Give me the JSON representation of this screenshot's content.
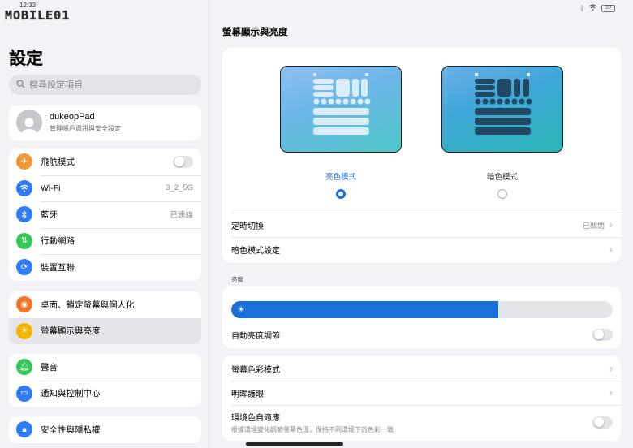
{
  "header": {
    "clock": "12:33",
    "logo_text": "MOBILE01"
  },
  "status": {
    "battery": "10"
  },
  "sidebar": {
    "title": "設定",
    "search_placeholder": "搜尋設定項目",
    "profile": {
      "name": "dukeopPad",
      "subtitle": "管理帳戶資訊與安全設定"
    },
    "group1": [
      {
        "label": "飛航模式",
        "icon": "airplane-icon",
        "color": "#f09a37"
      },
      {
        "label": "Wi-Fi",
        "value": "3_2_5G",
        "icon": "wifi-icon",
        "color": "#2f7cf6"
      },
      {
        "label": "藍牙",
        "value": "已連線",
        "icon": "bluetooth-icon",
        "color": "#2f7cf6"
      },
      {
        "label": "行動網路",
        "icon": "cellular-icon",
        "color": "#34c759"
      },
      {
        "label": "裝置互聯",
        "icon": "continuity-icon",
        "color": "#2f7cf6"
      }
    ],
    "group2": [
      {
        "label": "桌面、鎖定螢幕與個人化",
        "icon": "palette-icon",
        "color": "#f2742b"
      },
      {
        "label": "螢幕顯示與亮度",
        "icon": "brightness-icon",
        "color": "#f5b400"
      }
    ],
    "group3": [
      {
        "label": "聲音",
        "icon": "bell-icon",
        "color": "#34c759"
      },
      {
        "label": "通知與控制中心",
        "icon": "notification-icon",
        "color": "#2f7cf6"
      }
    ],
    "group4": [
      {
        "label": "安全性與隱私權",
        "icon": "lock-icon",
        "color": "#2f7cf6"
      }
    ]
  },
  "main": {
    "title": "螢幕顯示與亮度",
    "light_mode_label": "亮色模式",
    "dark_mode_label": "暗色模式",
    "schedule_label": "定時切換",
    "schedule_value": "已關閉",
    "dark_settings_label": "暗色模式設定",
    "brightness_section": "亮度",
    "brightness_level": 0.7,
    "auto_brightness_label": "自動亮度調節",
    "color_mode_label": "螢幕色彩模式",
    "eye_comfort_label": "明眸護眼",
    "ambient_label": "環境色自適應",
    "ambient_desc": "根據環境變化調節螢幕色溫，保持不同環境下的色彩一致"
  },
  "colors": {
    "accent": "#1a6fd8"
  }
}
